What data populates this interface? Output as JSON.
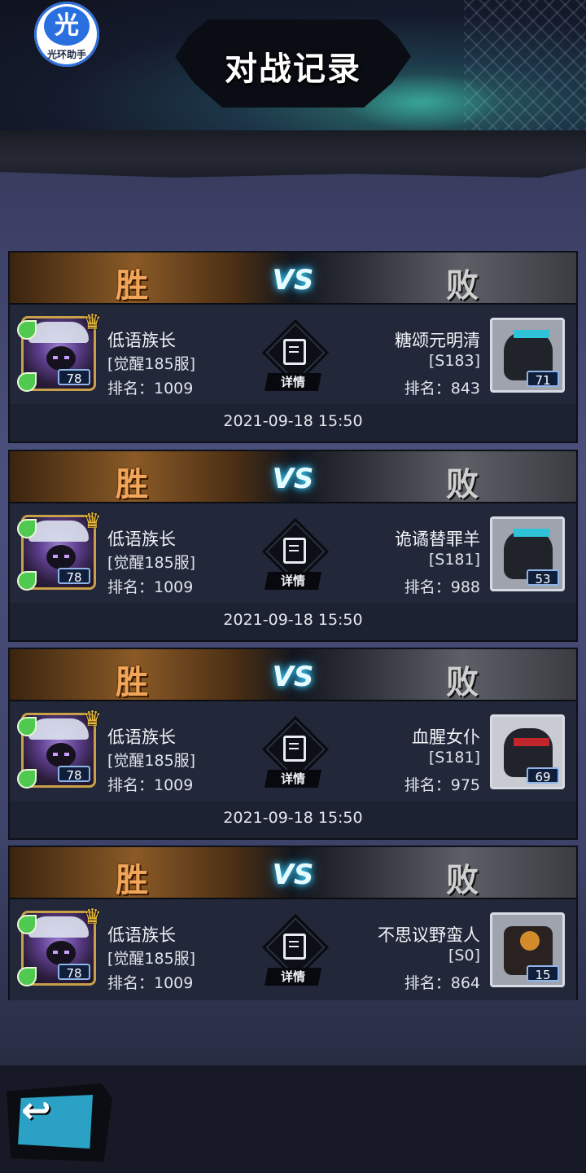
{
  "header": {
    "title": "对战记录",
    "logo_glyph": "光",
    "logo_text": "光环助手"
  },
  "labels": {
    "win": "胜",
    "vs": "VS",
    "lose": "败",
    "detail": "详情"
  },
  "records": [
    {
      "player": {
        "name": "低语族长",
        "server": "[觉醒185服]",
        "rank": "排名：1009",
        "level": "78"
      },
      "opponent": {
        "name": "糖颂元明清",
        "server": "[S183]",
        "rank": "排名：843",
        "level": "71",
        "avatar_icon": "blue-knight-avatar"
      },
      "time": "2021-09-18 15:50"
    },
    {
      "player": {
        "name": "低语族长",
        "server": "[觉醒185服]",
        "rank": "排名：1009",
        "level": "78"
      },
      "opponent": {
        "name": "诡谲替罪羊",
        "server": "[S181]",
        "rank": "排名：988",
        "level": "53",
        "avatar_icon": "blue-knight-avatar"
      },
      "time": "2021-09-18 15:50"
    },
    {
      "player": {
        "name": "低语族长",
        "server": "[觉醒185服]",
        "rank": "排名：1009",
        "level": "78"
      },
      "opponent": {
        "name": "血腥女仆",
        "server": "[S181]",
        "rank": "排名：975",
        "level": "69",
        "avatar_icon": "red-bandana-avatar"
      },
      "time": "2021-09-18 15:50"
    },
    {
      "player": {
        "name": "低语族长",
        "server": "[觉醒185服]",
        "rank": "排名：1009",
        "level": "78"
      },
      "opponent": {
        "name": "不思议野蛮人",
        "server": "[S0]",
        "rank": "排名：864",
        "level": "15",
        "avatar_icon": "lantern-avatar"
      }
    }
  ],
  "colors": {
    "win": "#f2a65a",
    "vs_glow": "#3fd6ff",
    "back_button": "#2ba1c6"
  }
}
